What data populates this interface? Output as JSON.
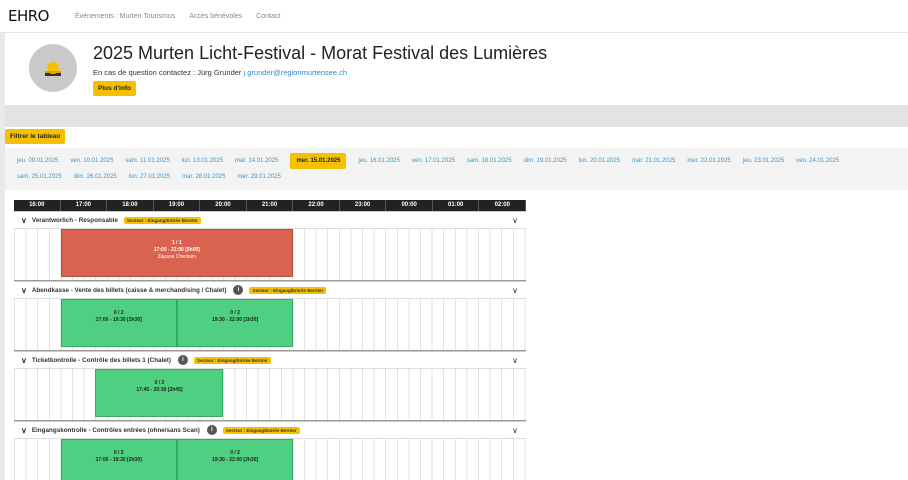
{
  "nav": {
    "logo": "EHRO",
    "links": [
      "Événements : Murten Tourismus",
      "Accès bénévoles",
      "Contact"
    ]
  },
  "header": {
    "title": "2025 Murten Licht-Festival - Morat Festival des Lumières",
    "contact_prefix": "En cas de question contactez : Jürg Grunder",
    "contact_email": "j.grunder@regionmurtensee.ch",
    "info_button": "Plus d'info"
  },
  "filter_button": "Filtrer le tableau",
  "dates_row1": [
    "jeu. 09.01.2025",
    "ven. 10.01.2025",
    "sam. 11.01.2025",
    "lun. 13.01.2025",
    "mar. 14.01.2025",
    "mer. 15.01.2025",
    "jeu. 16.01.2025",
    "ven. 17.01.2025",
    "sam. 18.01.2025",
    "dim. 19.01.2025",
    "lun. 20.01.2025",
    "mar. 21.01.2025",
    "mer. 22.01.2025",
    "jeu. 23.01.2025",
    "ven. 24.01.2025"
  ],
  "dates_row2": [
    "sam. 25.01.2025",
    "dim. 26.01.2025",
    "lun. 27.01.2025",
    "mar. 28.01.2025",
    "mer. 29.01.2025"
  ],
  "active_date": "mer. 15.01.2025",
  "hours": [
    "16:00",
    "17:00",
    "18:00",
    "19:00",
    "20:00",
    "21:00",
    "22:00",
    "23:00",
    "00:00",
    "01:00",
    "02:00"
  ],
  "sections": [
    {
      "title": "Verantworlich - Responsable",
      "badge": "Secteur : Eingang/Entrée Bernter",
      "has_info": false,
      "shifts": [
        {
          "count": "1 / 1",
          "time": "17:00 - 22:00 [5h00]",
          "person": "Zayane Cherbuin",
          "color": "red",
          "start": 17.0,
          "end": 22.0
        }
      ]
    },
    {
      "title": "Abendkasse - Vente des billets (caisse & merchandising / Chalet)",
      "badge": "Secteur : Eingang/Entrée Bernter",
      "has_info": true,
      "shifts": [
        {
          "count": "0 / 2",
          "time": "17:00 - 19:30 [2h30]",
          "person": "",
          "color": "green",
          "start": 17.0,
          "end": 19.5
        },
        {
          "count": "0 / 2",
          "time": "19:30 - 22:00 [2h30]",
          "person": "",
          "color": "green",
          "start": 19.5,
          "end": 22.0
        }
      ]
    },
    {
      "title": "Ticketkontrolle - Contrôle des billets 1 (Chalet)",
      "badge": "Secteur : Eingang/Entrée Bernter",
      "has_info": true,
      "shifts": [
        {
          "count": "0 / 2",
          "time": "17:45 - 20:30 [2h45]",
          "person": "",
          "color": "green",
          "start": 17.75,
          "end": 20.5
        }
      ]
    },
    {
      "title": "Eingangskontrolle - Contrôles entrées (ohne/sans Scan)",
      "badge": "Secteur : Eingang/Entrée Bernter",
      "has_info": true,
      "shifts": [
        {
          "count": "0 / 2",
          "time": "17:00 - 19:30 [2h30]",
          "person": "",
          "color": "green",
          "start": 17.0,
          "end": 19.5
        },
        {
          "count": "0 / 2",
          "time": "19:30 - 22:00 [2h30]",
          "person": "",
          "color": "green",
          "start": 19.5,
          "end": 22.0
        }
      ]
    }
  ],
  "colors": {
    "accent": "#f5c000",
    "link": "#3c96c9",
    "shift_full": "#d96350",
    "shift_open": "#4ecf82"
  },
  "icons": {
    "avatar": "sun-event-icon",
    "chevron": "chevron-down-icon",
    "info": "info-icon"
  }
}
